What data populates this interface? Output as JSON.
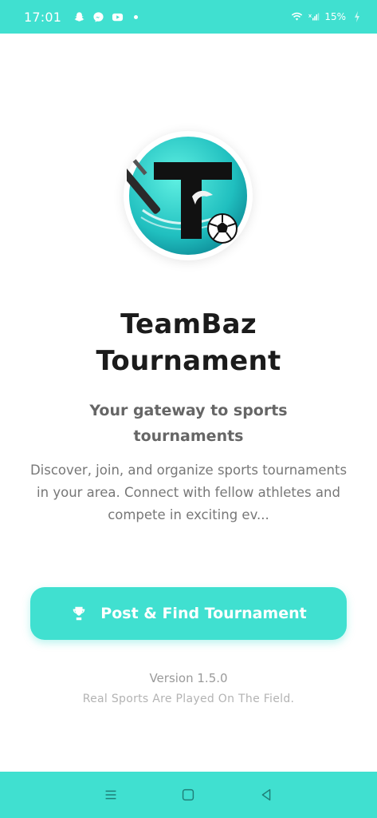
{
  "status_bar": {
    "time": "17:01",
    "notification_icons": [
      "snapchat-icon",
      "messenger-icon",
      "youtube-icon"
    ],
    "battery": "15%"
  },
  "app": {
    "title": "TeamBaz Tournament",
    "subtitle": "Your gateway to sports tournaments",
    "description": "Discover, join, and organize sports tournaments in your area. Connect with fellow athletes and compete in exciting ev...",
    "cta_label": "Post & Find Tournament",
    "version": "Version 1.5.0",
    "tagline": "Real Sports Are Played On The Field."
  },
  "colors": {
    "accent": "#40e0d0",
    "title": "#1b1b1b",
    "subtitle": "#666666",
    "muted": "#9a9a9a"
  },
  "nav_bar": {
    "buttons": [
      "menu-icon",
      "home-square-icon",
      "back-triangle-icon"
    ]
  }
}
